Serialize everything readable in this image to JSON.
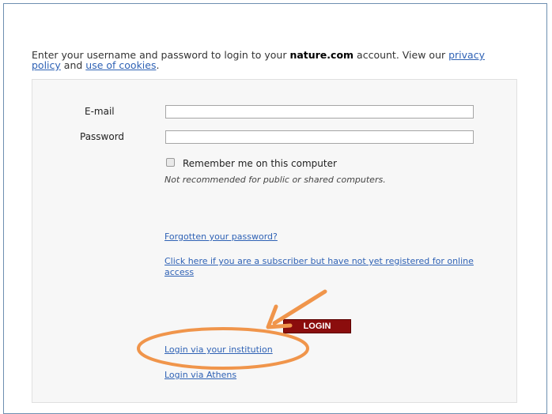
{
  "intro": {
    "text_before": "Enter your username and password to login to your ",
    "brand": "nature.com",
    "text_middle": " account. View our ",
    "privacy_link": "privacy policy",
    "text_and": " and ",
    "cookies_link": "use of cookies",
    "text_end": "."
  },
  "form": {
    "email_label": "E-mail",
    "email_value": "",
    "password_label": "Password",
    "password_value": "",
    "remember_label": "Remember me on this computer",
    "remember_checked": false,
    "remember_note": "Not recommended for public or shared computers.",
    "forgot_link": "Forgotten your password?",
    "subscriber_link": "Click here if you are a subscriber but have not yet registered for online access",
    "login_button": "LOGIN",
    "institution_link": "Login via your institution",
    "athens_link": "Login via Athens"
  },
  "colors": {
    "accent_link": "#2f62b5",
    "login_button_bg": "#8b0d0d",
    "highlight_orange": "#f0954b"
  }
}
